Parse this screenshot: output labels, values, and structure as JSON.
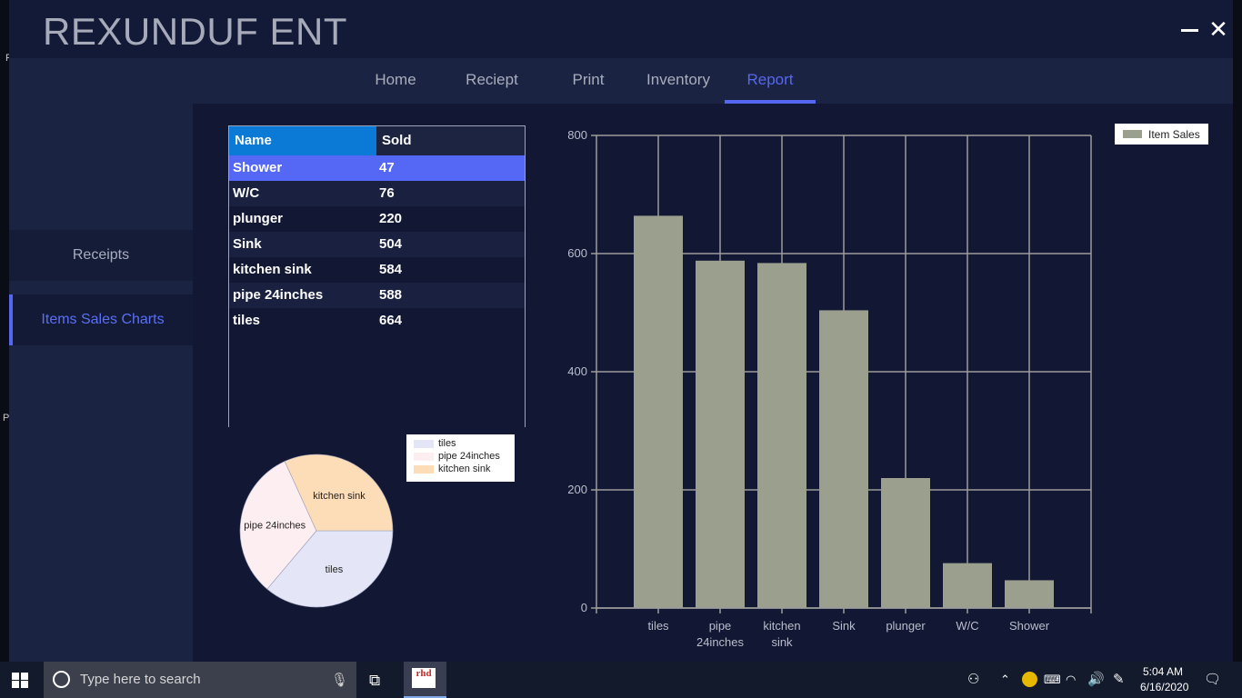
{
  "app": {
    "title": "REXUNDUF ENT",
    "minimize_symbol": "",
    "close_symbol": "✕"
  },
  "edge_chars": [
    "F",
    "P"
  ],
  "nav": {
    "tabs": [
      {
        "label": "Home"
      },
      {
        "label": "Reciept"
      },
      {
        "label": "Print"
      },
      {
        "label": "Inventory"
      },
      {
        "label": "Report",
        "active": true
      }
    ]
  },
  "sidebar": {
    "items": [
      {
        "label": "Receipts"
      },
      {
        "label": "Items Sales Charts",
        "active": true
      }
    ]
  },
  "table": {
    "headers": [
      "Name",
      "Sold"
    ],
    "rows": [
      {
        "name": "Shower",
        "sold": "47"
      },
      {
        "name": "W/C",
        "sold": "76"
      },
      {
        "name": "plunger",
        "sold": "220"
      },
      {
        "name": "Sink",
        "sold": "504"
      },
      {
        "name": "kitchen sink",
        "sold": "584"
      },
      {
        "name": "pipe 24inches",
        "sold": "588"
      },
      {
        "name": "tiles",
        "sold": "664"
      }
    ],
    "selected_row": 0
  },
  "chart_data": [
    {
      "type": "pie",
      "legend": [
        "tiles",
        "pipe 24inches",
        "kitchen sink"
      ],
      "slices": [
        {
          "label": "tiles",
          "value": 664,
          "color": "#e4e6f8"
        },
        {
          "label": "pipe 24inches",
          "value": 588,
          "color": "#fdeef2"
        },
        {
          "label": "kitchen sink",
          "value": 584,
          "color": "#fddcb8"
        }
      ],
      "legend_position": "top-right"
    },
    {
      "type": "bar",
      "series_name": "Item Sales",
      "categories": [
        "tiles",
        "pipe 24inches",
        "kitchen sink",
        "Sink",
        "plunger",
        "W/C",
        "Shower"
      ],
      "category_lines": [
        [
          "tiles"
        ],
        [
          "pipe",
          "24inches"
        ],
        [
          "kitchen",
          "sink"
        ],
        [
          "Sink"
        ],
        [
          "plunger"
        ],
        [
          "W/C"
        ],
        [
          "Shower"
        ]
      ],
      "values": [
        664,
        588,
        584,
        504,
        220,
        76,
        47
      ],
      "ylim": [
        0,
        800
      ],
      "yticks": [
        0,
        200,
        400,
        600,
        800
      ],
      "grid": true,
      "bar_color": "#9b9f8e",
      "legend_position": "top-right"
    }
  ],
  "taskbar": {
    "search_placeholder": "Type here to search",
    "app_icon_label": "rhd",
    "time": "5:04 AM",
    "date": "6/16/2020"
  },
  "colors": {
    "accent": "#5567f0",
    "header_blue": "#0a7ad6",
    "background": "#121a38"
  }
}
